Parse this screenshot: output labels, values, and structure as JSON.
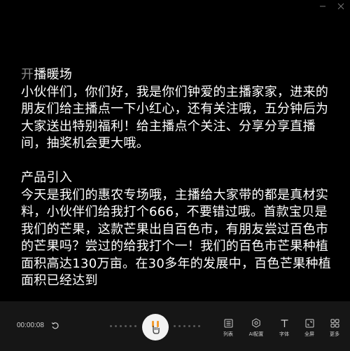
{
  "content": {
    "sections": [
      {
        "title_first": "开",
        "title_rest": "播暖场",
        "text": "小伙伴们，你们好，我是你们钟爱的主播家家，进来的朋友们给主播点一下小红心，还有关注哦，五分钟后为大家送出特别福利！给主播点个关注、分享分享直播间，抽奖机会更大哦。"
      },
      {
        "title": "产品引入",
        "text": "今天是我们的惠农专场哦，主播给大家带的都是真材实料，小伙伴们给我打个666，不要错过哦。首款宝贝是我们的芒果，这款芒果出自百色市，有朋友尝过百色市的芒果吗？尝过的给我打个一！我们的百色市芒果种植面积高达130万亩。在30多年的发展中，百色芒果种植面积已经达到"
      }
    ]
  },
  "toolbar": {
    "time": "00:00:08",
    "tools": [
      {
        "label": "列表",
        "icon": "list-icon"
      },
      {
        "label": "AI配置",
        "icon": "ai-config-icon"
      },
      {
        "label": "字体",
        "icon": "font-icon"
      },
      {
        "label": "全屏",
        "icon": "fullscreen-icon"
      },
      {
        "label": "更多",
        "icon": "more-icon"
      }
    ]
  },
  "colors": {
    "background": "#000000",
    "toolbar": "#161616",
    "text": "#ffffff",
    "play_button": "#f2f2f2",
    "play_accent": "#f39b2f"
  }
}
